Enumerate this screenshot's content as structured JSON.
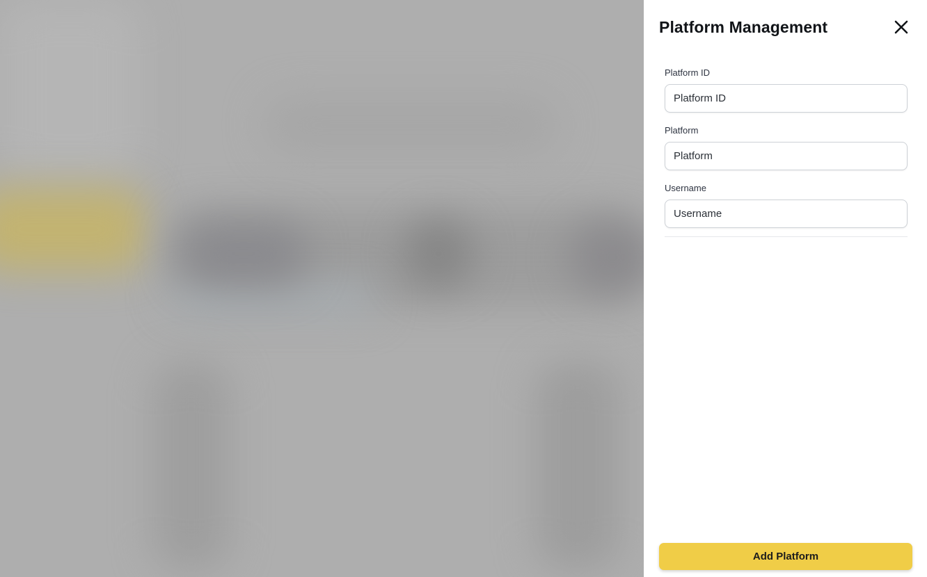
{
  "panel": {
    "title": "Platform Management",
    "close_icon": "close-icon"
  },
  "form": {
    "fields": [
      {
        "label": "Platform ID",
        "placeholder": "Platform ID",
        "value": ""
      },
      {
        "label": "Platform",
        "placeholder": "Platform",
        "value": ""
      },
      {
        "label": "Username",
        "placeholder": "Username",
        "value": ""
      }
    ]
  },
  "actions": {
    "submit_label": "Add Platform"
  },
  "colors": {
    "accent": "#f0cd47",
    "overlay": "#aeaeae",
    "panel_bg": "#ffffff"
  }
}
